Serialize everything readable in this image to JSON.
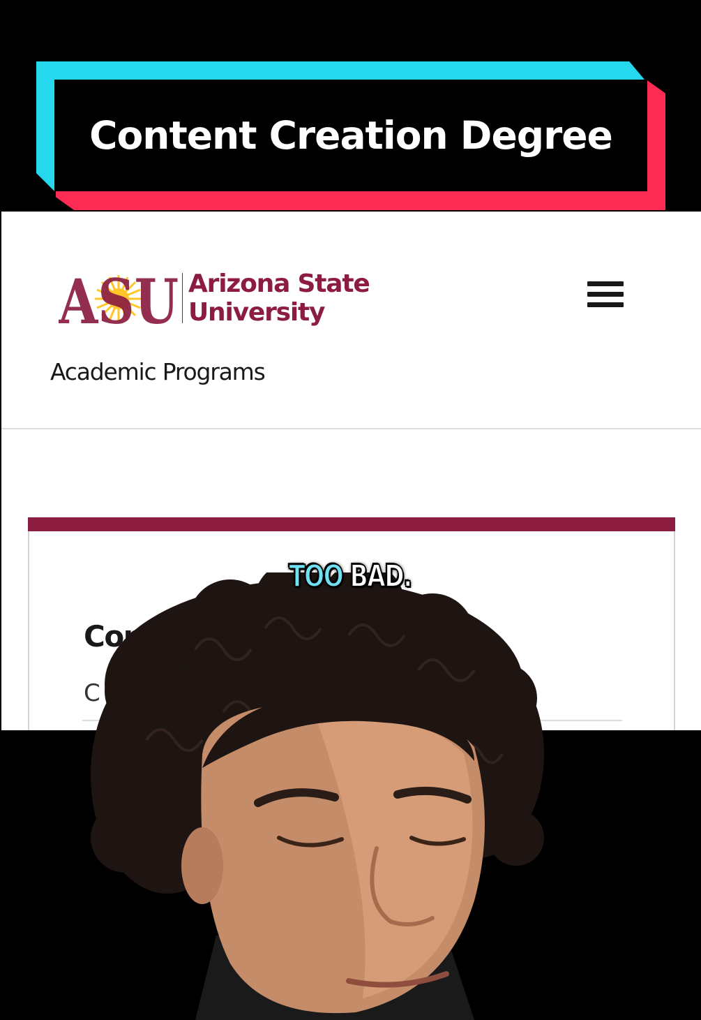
{
  "banner": {
    "title": "Content Creation Degree"
  },
  "header": {
    "logo_mark": "ASU",
    "logo_line1": "Arizona State",
    "logo_line2": "University",
    "section_title": "Academic Programs",
    "menu_icon": "hamburger-menu-icon"
  },
  "card": {
    "heading_partial": "Cont",
    "sub_partial": "C"
  },
  "caption": {
    "word1": "TOO",
    "word2": "BAD."
  },
  "colors": {
    "asu_maroon": "#8c1d40",
    "asu_gold": "#ffc627",
    "tiktok_cyan": "#25d8ed",
    "tiktok_red": "#fe2b54"
  }
}
